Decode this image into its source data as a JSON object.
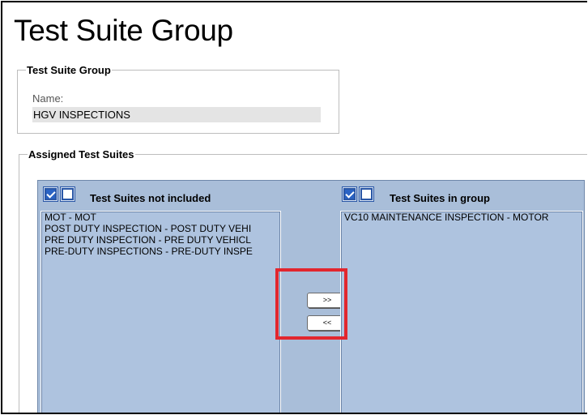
{
  "page": {
    "title": "Test Suite Group"
  },
  "group_section": {
    "legend": "Test Suite Group",
    "name_label": "Name:",
    "name_value": "HGV INSPECTIONS"
  },
  "assigned_section": {
    "legend": "Assigned Test Suites",
    "not_included": {
      "header": "Test Suites not included",
      "select_all_checked": true,
      "select_none_checked": false,
      "items": [
        "MOT - MOT",
        "POST DUTY INSPECTION - POST DUTY VEHI",
        "PRE DUTY INSPECTION - PRE DUTY VEHICL",
        "PRE-DUTY INSPECTIONS - PRE-DUTY INSPE"
      ]
    },
    "in_group": {
      "header": "Test Suites in group",
      "select_all_checked": true,
      "select_none_checked": false,
      "items": [
        "VC10 MAINTENANCE INSPECTION - MOTOR"
      ]
    },
    "buttons": {
      "add_label": ">>",
      "remove_label": "<<"
    },
    "highlight_color": "#e2262e"
  },
  "colors": {
    "panel_bg": "#a9bed9",
    "checkbox_blue": "#2a63c4"
  }
}
